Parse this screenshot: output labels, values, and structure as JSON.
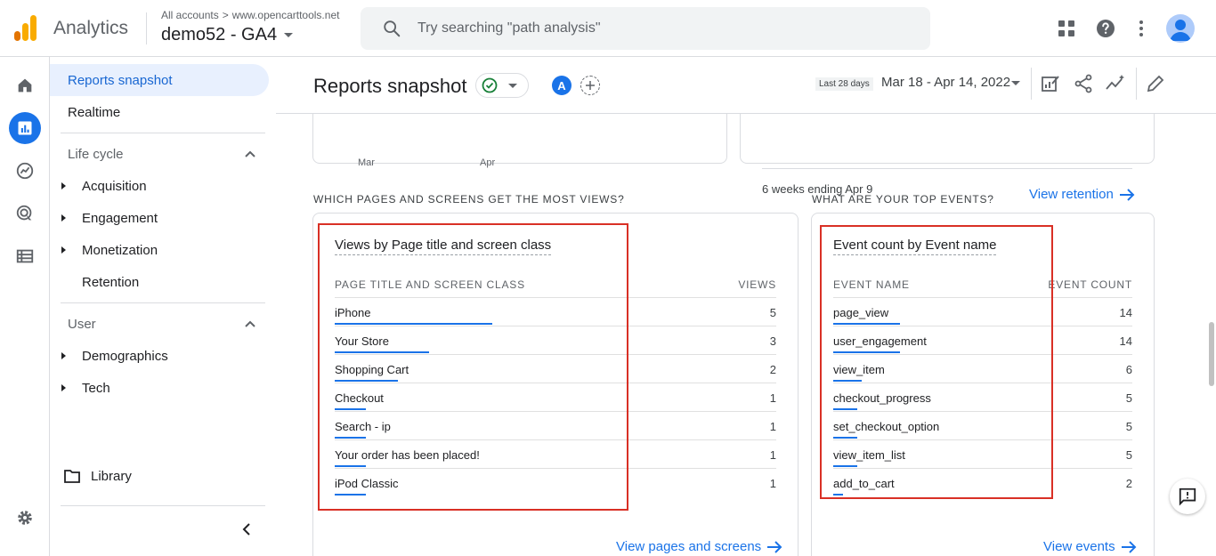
{
  "app": {
    "name": "Analytics",
    "breadcrumb_root": "All accounts",
    "breadcrumb_sep": ">",
    "breadcrumb_account": "www.opencarttools.net",
    "property": "demo52 - GA4",
    "search_placeholder": "Try searching \"path analysis\"",
    "icons": [
      "apps-grid-icon",
      "help-icon",
      "more-vert-icon",
      "account-avatar-icon"
    ]
  },
  "rail": {
    "items": [
      "home-icon",
      "reports-icon",
      "explore-icon",
      "advertising-icon",
      "configure-icon",
      "settings-icon"
    ],
    "active": "reports-icon"
  },
  "nav": {
    "reports_snapshot": "Reports snapshot",
    "realtime": "Realtime",
    "lifecycle": "Life cycle",
    "acquisition": "Acquisition",
    "engagement": "Engagement",
    "monetization": "Monetization",
    "retention": "Retention",
    "user": "User",
    "demographics": "Demographics",
    "tech": "Tech",
    "library": "Library"
  },
  "header": {
    "title": "Reports snapshot",
    "comparison_badge": "A",
    "range_label": "Last 28 days",
    "range_value": "Mar 18 - Apr 14, 2022"
  },
  "top_cards": {
    "axis_left": [
      "Mar",
      "Apr"
    ],
    "retention_note": "6 weeks ending Apr 9",
    "retention_link": "View retention"
  },
  "pages_card": {
    "section": "WHICH PAGES AND SCREENS GET THE MOST VIEWS?",
    "title": "Views by Page title and screen class",
    "col_name": "PAGE TITLE AND SCREEN CLASS",
    "col_value": "VIEWS",
    "rows": [
      {
        "name": "iPhone",
        "value": "5"
      },
      {
        "name": "Your Store",
        "value": "3"
      },
      {
        "name": "Shopping Cart",
        "value": "2"
      },
      {
        "name": "Checkout",
        "value": "1"
      },
      {
        "name": "Search - ip",
        "value": "1"
      },
      {
        "name": "Your order has been placed!",
        "value": "1"
      },
      {
        "name": "iPod Classic",
        "value": "1"
      }
    ],
    "link": "View pages and screens"
  },
  "events_card": {
    "section": "WHAT ARE YOUR TOP EVENTS?",
    "title": "Event count by Event name",
    "col_name": "EVENT NAME",
    "col_value": "EVENT COUNT",
    "rows": [
      {
        "name": "page_view",
        "value": "14"
      },
      {
        "name": "user_engagement",
        "value": "14"
      },
      {
        "name": "view_item",
        "value": "6"
      },
      {
        "name": "checkout_progress",
        "value": "5"
      },
      {
        "name": "set_checkout_option",
        "value": "5"
      },
      {
        "name": "view_item_list",
        "value": "5"
      },
      {
        "name": "add_to_cart",
        "value": "2"
      }
    ],
    "link": "View events"
  },
  "colors": {
    "accent": "#1a73e8",
    "highlight": "#d93025"
  }
}
